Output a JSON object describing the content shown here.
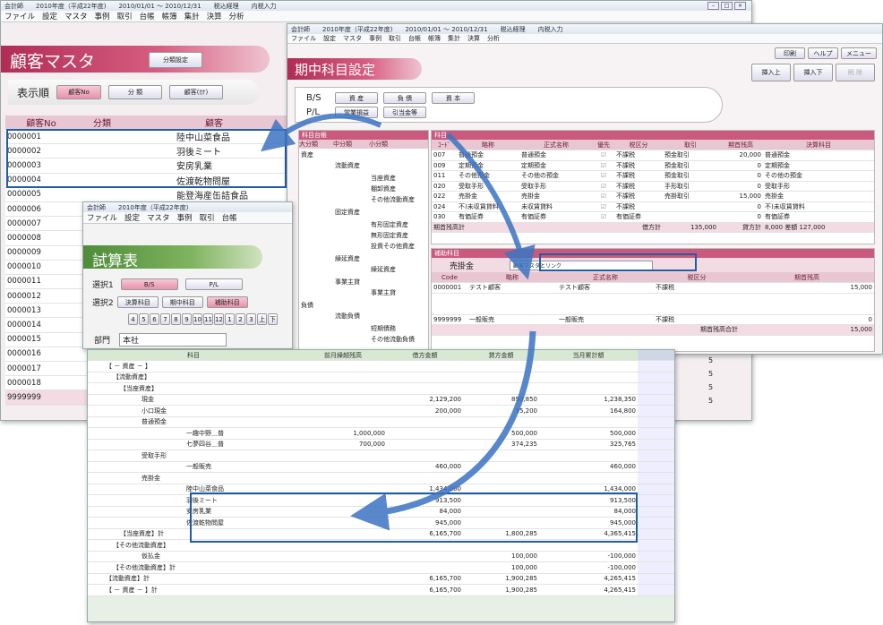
{
  "app": {
    "name": "会計師",
    "era": "2010年度（平成22年度)",
    "period": "2010/01/01 ～ 2010/12/31",
    "tax": "税込経理",
    "entry": "内税入力"
  },
  "menu": [
    "ファイル",
    "設定",
    "マスタ",
    "事例",
    "取引",
    "台帳",
    "帳簿",
    "集計",
    "決算",
    "分析"
  ],
  "cust": {
    "title": "顧客マスタ",
    "group_btn": "分類設定",
    "order_label": "表示順",
    "order_opts": [
      "顧客No",
      "分 類",
      "顧客(ｶﾅ)"
    ],
    "cols": [
      "顧客No",
      "分類",
      "顧客"
    ],
    "rows": [
      [
        "0000001",
        "",
        "陸中山菜食品"
      ],
      [
        "0000002",
        "",
        "羽後ミート"
      ],
      [
        "0000003",
        "",
        "安房乳業"
      ],
      [
        "0000004",
        "",
        "佐渡乾物問屋"
      ],
      [
        "0000005",
        "",
        "能登海産缶詰食品"
      ],
      [
        "0000006",
        "",
        ""
      ],
      [
        "0000007",
        "",
        ""
      ],
      [
        "0000008",
        "",
        ""
      ],
      [
        "0000009",
        "",
        ""
      ],
      [
        "0000010",
        "",
        ""
      ],
      [
        "0000011",
        "",
        ""
      ],
      [
        "0000012",
        "",
        ""
      ],
      [
        "0000013",
        "",
        ""
      ],
      [
        "0000014",
        "",
        ""
      ],
      [
        "0000015",
        "",
        ""
      ],
      [
        "0000016",
        "",
        ""
      ],
      [
        "0000017",
        "",
        ""
      ],
      [
        "0000018",
        "",
        ""
      ],
      [
        "9999999",
        "",
        ""
      ]
    ],
    "right_vals": [
      "5",
      "5",
      "5",
      "5"
    ]
  },
  "kamoku": {
    "title": "期中科目設定",
    "toolbar": [
      "印刷",
      "ヘルプ",
      "メニュー"
    ],
    "actions": [
      "挿入上",
      "挿入下",
      "削 除"
    ],
    "bs": "B/S",
    "pl": "P/L",
    "bs_btns": [
      "資 産",
      "負 債",
      "資 本"
    ],
    "pl_btns": [
      "営業損益",
      "引当金等"
    ],
    "ledger_title": "科目台帳",
    "ledger_cols": [
      "大分類",
      "中分類",
      "小分類"
    ],
    "ledger_items": [
      "資産",
      "流動資産",
      "当座資産",
      "棚卸資産",
      "その他流動資産",
      "固定資産",
      "有形固定資産",
      "無形固定資産",
      "投資その他資産",
      "繰延資産",
      "繰延資産",
      "事業主貸",
      "事業主貸",
      "負債",
      "流動負債",
      "短期債務",
      "その他流動負債"
    ],
    "acct_title": "科目",
    "acct_cols": [
      "ｺｰﾄﾞ",
      "略称",
      "正式名称",
      "優先",
      "税区分",
      "取引",
      "期首残高",
      "決算科目"
    ],
    "acct_rows": [
      [
        "007",
        "普通預金",
        "普通預金",
        "不課税",
        "預金取引",
        "20,000",
        "普通預金"
      ],
      [
        "009",
        "定期預金",
        "定期預金",
        "不課税",
        "預金取引",
        "0",
        "定期預金"
      ],
      [
        "011",
        "その他預金",
        "その他の預金",
        "不課税",
        "預金取引",
        "0",
        "その他の預金"
      ],
      [
        "020",
        "受取手形",
        "受取手形",
        "不課税",
        "手形取引",
        "0",
        "受取手形"
      ],
      [
        "022",
        "売掛金",
        "売掛金",
        "不課税",
        "売掛取引",
        "15,000",
        "売掛金"
      ],
      [
        "024",
        "不)未収賃貸料",
        "未収賃貸料",
        "不課税",
        "",
        "0",
        "不)未収賃貸料"
      ],
      [
        "030",
        "有価証券",
        "有価証券",
        "有価証券",
        "",
        "0",
        "有価証券"
      ]
    ],
    "sum_label": "期首残高計",
    "debit_label": "借方計",
    "debit": "135,000",
    "credit_label": "貸方計",
    "credit": "8,000",
    "diff_label": "差額",
    "diff": "127,000",
    "sub_title": "補助科目",
    "sub_acct": "売掛金",
    "sub_link": "顧客マスタとリンク",
    "sub_cols": [
      "Code",
      "略称",
      "正式名称",
      "税区分",
      "期首残高"
    ],
    "sub_rows": [
      [
        "0000001",
        "テスト顧客",
        "テスト顧客",
        "不課税",
        "15,000"
      ],
      [
        "9999999",
        "一般販売",
        "一般販売",
        "不課税",
        "0"
      ]
    ],
    "sub_total_label": "期首残高合計",
    "sub_total": "15,000"
  },
  "trial": {
    "title": "試算表",
    "sel1": "選択1",
    "sel2": "選択2",
    "b1": [
      "B/S",
      "P/L"
    ],
    "b2": [
      "決算科目",
      "期中科目",
      "補助科目"
    ],
    "months": [
      "4",
      "5",
      "6",
      "7",
      "8",
      "9",
      "10",
      "11",
      "12",
      "1",
      "2",
      "3",
      "上",
      "下"
    ],
    "dept": "部門",
    "dept_val": "本社",
    "cols": [
      "科目",
      "前月繰越残高",
      "借方金額",
      "貸方金額",
      "当月累計額"
    ],
    "rows": [
      [
        "【 － 資産 － 】",
        "",
        "",
        "",
        ""
      ],
      [
        "【流動資産】",
        "",
        "",
        "",
        ""
      ],
      [
        "【当座資産】",
        "",
        "",
        "",
        ""
      ],
      [
        "現金",
        "",
        "2,129,200",
        "890,850",
        "1,238,350"
      ],
      [
        "小口現金",
        "",
        "200,000",
        "35,200",
        "164,800"
      ],
      [
        "普通預金",
        "",
        "",
        "",
        ""
      ],
      [
        "一趣中野＿普",
        "1,000,000",
        "",
        "500,000",
        "500,000"
      ],
      [
        "七夢四谷＿普",
        "700,000",
        "",
        "374,235",
        "325,765"
      ],
      [
        "受取手形",
        "",
        "",
        "",
        ""
      ],
      [
        "一般販売",
        "",
        "460,000",
        "",
        "460,000"
      ],
      [
        "売掛金",
        "",
        "",
        "",
        ""
      ],
      [
        "陸中山菜食品",
        "",
        "1,434,000",
        "",
        "1,434,000"
      ],
      [
        "羽後ミート",
        "",
        "913,500",
        "",
        "913,500"
      ],
      [
        "安房乳業",
        "",
        "84,000",
        "",
        "84,000"
      ],
      [
        "佐渡乾物問屋",
        "",
        "945,000",
        "",
        "945,000"
      ],
      [
        "【当座資産】計",
        "",
        "6,165,700",
        "1,800,285",
        "4,365,415"
      ],
      [
        "【その他流動資産】",
        "",
        "",
        "",
        ""
      ],
      [
        "仮払金",
        "",
        "",
        "100,000",
        "-100,000"
      ],
      [
        "【その他流動資産】計",
        "",
        "",
        "100,000",
        "-100,000"
      ],
      [
        "【流動資産】計",
        "",
        "6,165,700",
        "1,900,285",
        "4,265,415"
      ],
      [
        "【 － 資産 － 】計",
        "",
        "6,165,700",
        "1,900,285",
        "4,265,415"
      ]
    ]
  }
}
